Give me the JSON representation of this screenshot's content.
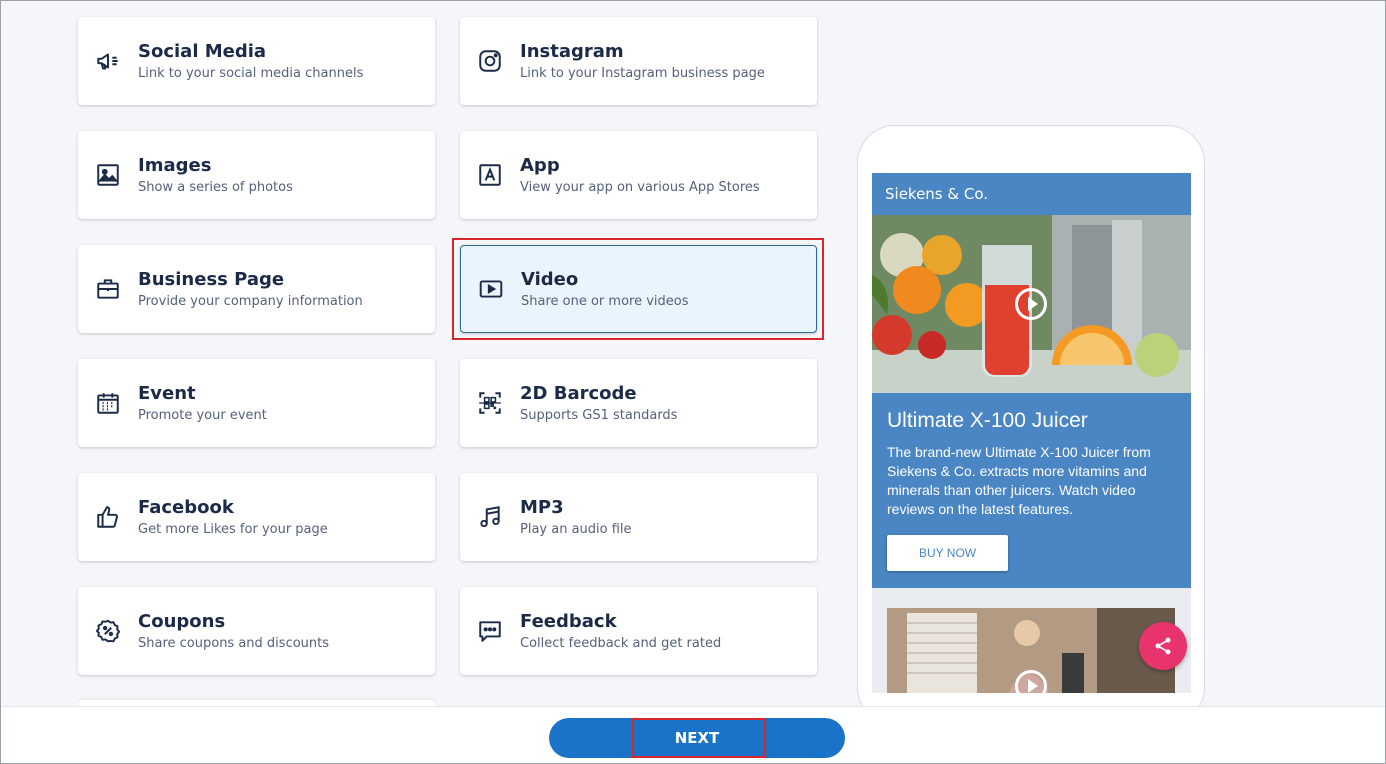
{
  "cards": [
    {
      "title": "Social Media",
      "subtitle": "Link to your social media channels",
      "icon": "megaphone-icon"
    },
    {
      "title": "Instagram",
      "subtitle": "Link to your Instagram business page",
      "icon": "instagram-icon"
    },
    {
      "title": "Images",
      "subtitle": "Show a series of photos",
      "icon": "image-icon"
    },
    {
      "title": "App",
      "subtitle": "View your app on various App Stores",
      "icon": "app-store-icon"
    },
    {
      "title": "Business Page",
      "subtitle": "Provide your company information",
      "icon": "briefcase-icon"
    },
    {
      "title": "Video",
      "subtitle": "Share one or more videos",
      "icon": "video-icon",
      "selected": true
    },
    {
      "title": "Event",
      "subtitle": "Promote your event",
      "icon": "calendar-icon"
    },
    {
      "title": "2D Barcode",
      "subtitle": "Supports GS1 standards",
      "icon": "barcode-scan-icon"
    },
    {
      "title": "Facebook",
      "subtitle": "Get more Likes for your page",
      "icon": "thumbs-up-icon"
    },
    {
      "title": "MP3",
      "subtitle": "Play an audio file",
      "icon": "music-note-icon"
    },
    {
      "title": "Coupons",
      "subtitle": "Share coupons and discounts",
      "icon": "coupon-icon"
    },
    {
      "title": "Feedback",
      "subtitle": "Collect feedback and get rated",
      "icon": "feedback-icon"
    }
  ],
  "preview": {
    "brand": "Siekens & Co.",
    "headline": "Ultimate X-100 Juicer",
    "body": "The brand-new Ultimate X-100 Juicer from Siekens & Co. extracts more vitamins and minerals than other juicers. Watch video reviews on the latest features.",
    "cta": "BUY NOW"
  },
  "footer": {
    "next_label": "NEXT"
  },
  "colors": {
    "accent": "#1a73c9",
    "preview_blue": "#4a86c4",
    "share_pink": "#e8336d",
    "highlight_red": "#d7262c"
  }
}
